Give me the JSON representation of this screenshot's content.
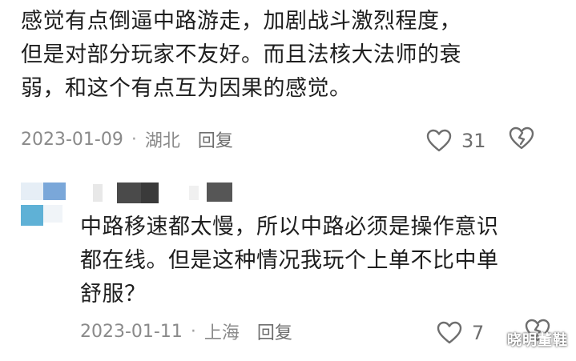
{
  "comments": [
    {
      "lines": [
        "感觉有点倒逼中路游走，加剧战斗激烈程度，",
        "但是对部分玩家不友好。而且法核大法师的衰",
        "弱，和这个有点互为因果的感觉。"
      ],
      "date": "2023-01-09",
      "separator": "·",
      "location": "湖北",
      "reply_label": "回复",
      "like_count": "31",
      "like_icon": "heart-outline-icon",
      "dislike_icon": "broken-heart-icon"
    },
    {
      "lines": [
        "中路移速都太慢，所以中路必须是操作意识",
        "都在线。但是这种情况我玩个上单不比中单",
        "舒服？"
      ],
      "date": "2023-01-11",
      "separator": "·",
      "location": "上海",
      "reply_label": "回复",
      "like_count": "7",
      "like_icon": "heart-outline-icon",
      "dislike_icon": "broken-heart-icon"
    }
  ],
  "watermark": "晓明董鞋",
  "colors": {
    "text": "#1e1e1e",
    "meta": "#8a8a8a",
    "icon": "#6e6e6e",
    "avatar_blue": "#7aa7d9",
    "avatar_cyan": "#5fb1d6"
  }
}
